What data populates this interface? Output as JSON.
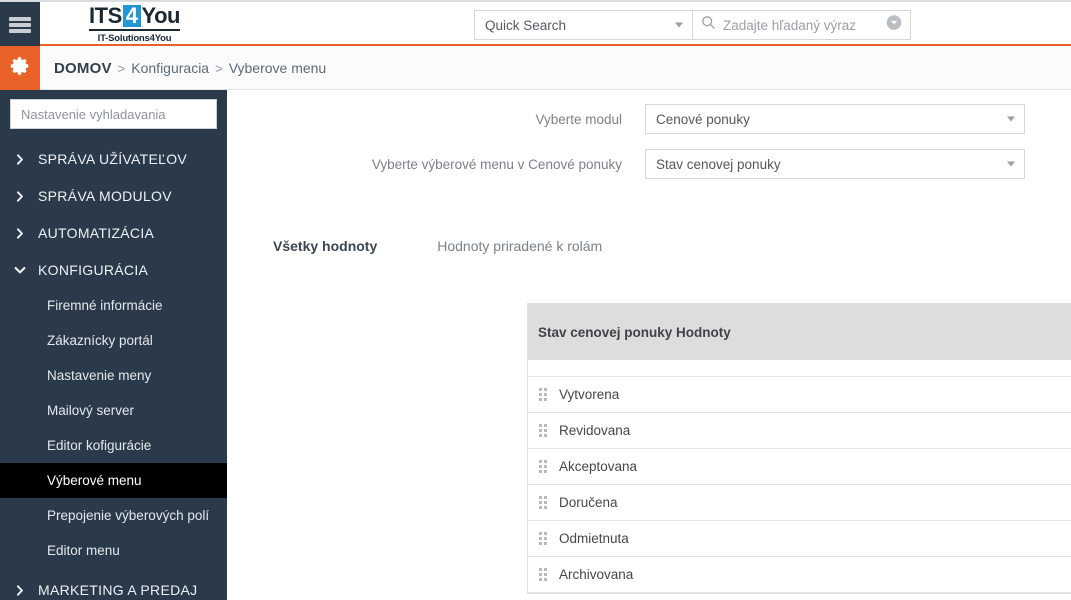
{
  "header": {
    "hamburger_icon": "hamburger-icon",
    "logo": {
      "part1": "ITS",
      "accent": "4",
      "part2": "You",
      "tagline": "IT-Solutions4You"
    },
    "quick_search": {
      "selected": "Quick Search",
      "search_placeholder": "Zadajte hľadaný výraz",
      "search_icon": "search-icon",
      "dropdown_icon": "circle-chevron-down-icon"
    }
  },
  "breadcrumb": {
    "gear_icon": "gear-icon",
    "home": "DOMOV",
    "separator": ">",
    "level2": "Konfiguracia",
    "current": "Vyberove menu"
  },
  "sidebar": {
    "search_placeholder": "Nastavenie vyhladavania",
    "groups": [
      {
        "label": "SPRÁVA UŽÍVATEĽOV",
        "icon": "chevron-right-icon",
        "expanded": false
      },
      {
        "label": "SPRÁVA MODULOV",
        "icon": "chevron-right-icon",
        "expanded": false
      },
      {
        "label": "AUTOMATIZÁCIA",
        "icon": "chevron-right-icon",
        "expanded": false
      },
      {
        "label": "KONFIGURÁCIA",
        "icon": "chevron-down-icon",
        "expanded": true
      }
    ],
    "items": [
      {
        "label": "Firemné informácie",
        "active": false
      },
      {
        "label": "Zákaznícky portál",
        "active": false
      },
      {
        "label": "Nastavenie meny",
        "active": false
      },
      {
        "label": "Mailový server",
        "active": false
      },
      {
        "label": "Editor kofigurácie",
        "active": false
      },
      {
        "label": "Výberové menu",
        "active": true
      },
      {
        "label": "Prepojenie výberových polí",
        "active": false
      },
      {
        "label": "Editor menu",
        "active": false
      }
    ],
    "last_group": {
      "label": "MARKETING A PREDAJ",
      "icon": "chevron-right-icon"
    }
  },
  "main": {
    "field_module": {
      "label": "Vyberte modul",
      "value": "Cenové ponuky",
      "caret_icon": "caret-down-icon"
    },
    "field_picklist": {
      "label": "Vyberte výberové menu v Cenové ponuky",
      "value": "Stav cenovej ponuky",
      "caret_icon": "caret-down-icon"
    },
    "tabs": [
      {
        "label": "Všetky hodnoty",
        "active": true
      },
      {
        "label": "Hodnoty priradené k rolám",
        "active": false
      }
    ],
    "table": {
      "header": "Stav cenovej ponuky Hodnoty",
      "drag_icon": "drag-handle-icon",
      "rows": [
        {
          "label": "Vytvorena"
        },
        {
          "label": "Revidovana"
        },
        {
          "label": "Akceptovana"
        },
        {
          "label": "Doručena"
        },
        {
          "label": "Odmietnuta"
        },
        {
          "label": "Archivovana"
        }
      ]
    }
  },
  "colors": {
    "navy": "#2b3a4a",
    "orange": "#e8622a",
    "logo_blue": "#2196d3",
    "active_item": "#000000",
    "table_header": "#dddddd"
  }
}
